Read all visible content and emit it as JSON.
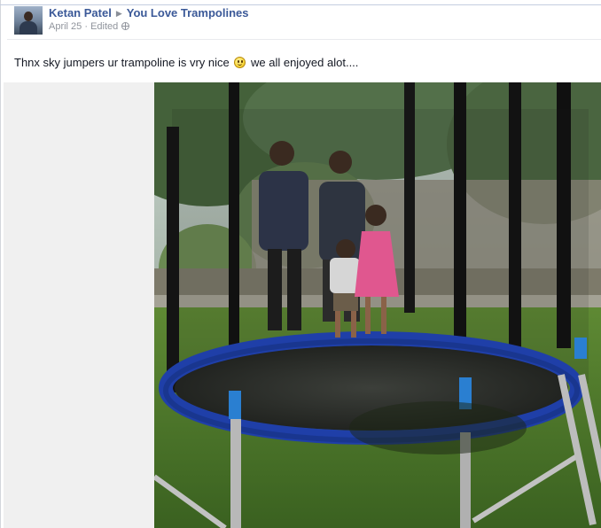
{
  "post": {
    "author": "Ketan Patel",
    "arrow_glyph": "▶",
    "group": "You Love Trampolines",
    "date": "April 25",
    "dot": " · ",
    "edited": "Edited",
    "text_before": "Thnx sky jumpers ur trampoline is vry nice",
    "text_after": "we all enjoyed alot....",
    "privacy_icon": "globe-icon",
    "emoji_icon": "smiley-icon"
  },
  "colors": {
    "link": "#3b5998",
    "meta": "#90949c",
    "trampoline_pad": "#1f3fa8",
    "grass": "#3f6b22"
  }
}
